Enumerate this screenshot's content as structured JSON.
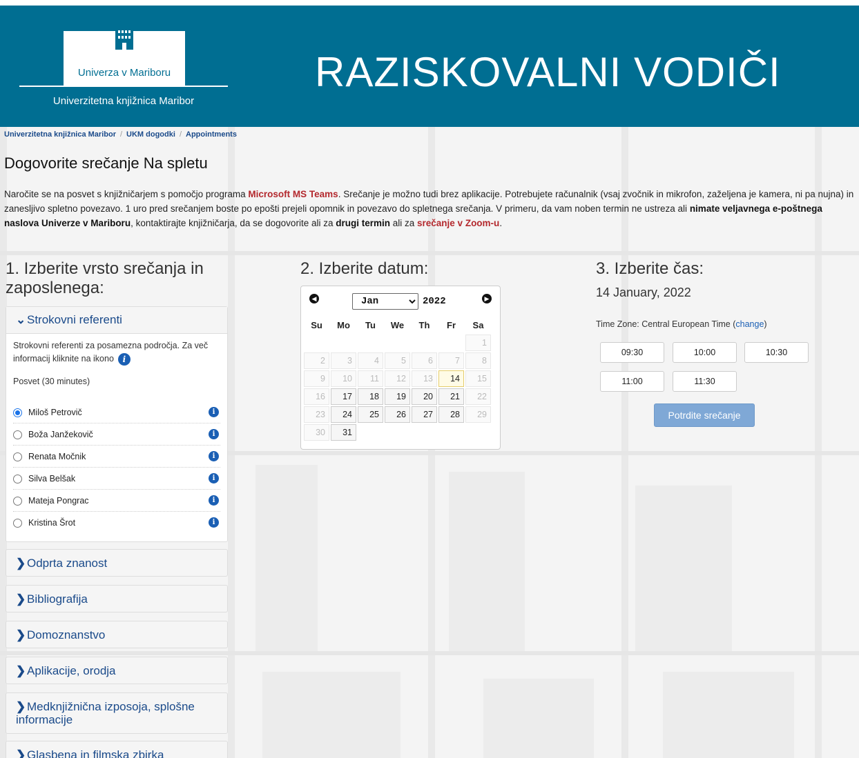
{
  "header": {
    "logo_name": "Univerza v Mariboru",
    "logo_sub": "Univerzitetna knjižnica Maribor",
    "site_title": "RAZISKOVALNI VODIČI",
    "bg_color": "#006e92"
  },
  "breadcrumbs": [
    "Univerzitetna knjižnica Maribor",
    "UKM dogodki",
    "Appointments"
  ],
  "page_title": "Dogovorite srečanje Na spletu",
  "intro": {
    "p1": "Naročite se na posvet s knjižničarjem s pomočjo programa ",
    "teams": "Microsoft MS Teams",
    "p2": ". Srečanje je možno tudi brez aplikacije. Potrebujete računalnik (vsaj zvočnik in mikrofon, zaželjena je kamera, ni pa nujna) in zanesljivo spletno povezavo. 1 uro pred srečanjem boste po epošti prejeli opomnik in povezavo do spletnega srečanja. V primeru, da vam noben termin ne ustreza ali ",
    "no_email": "nimate veljavnega e-poštnega naslova Univerze v Mariboru",
    "p3": ", kontaktirajte knjižničarja, da se dogovorite ali za ",
    "other_term": "drugi termin",
    "p4": " ali za ",
    "zoom": "srečanje v Zoom-u",
    "p5": "."
  },
  "step1": {
    "heading": "1. Izberite vrsto srečanja in zaposlenega:",
    "open_panel": {
      "title": "Strokovni referenti",
      "description": "Strokovni referenti za posamezna področja. Za več informacij kliknite na ikono",
      "duration": "Posvet (30 minutes)",
      "staff": [
        {
          "name": "Miloš Petrovič",
          "selected": true
        },
        {
          "name": "Boža Janžekovič",
          "selected": false
        },
        {
          "name": "Renata Močnik",
          "selected": false
        },
        {
          "name": "Silva Belšak",
          "selected": false
        },
        {
          "name": "Mateja Pongrac",
          "selected": false
        },
        {
          "name": "Kristina Šrot",
          "selected": false
        }
      ]
    },
    "panels": [
      "Odprta znanost",
      "Bibliografija",
      "Domoznanstvo",
      "Aplikacije, orodja",
      "Medknjižnična izposoja, splošne informacije",
      "Glasbena in filmska zbirka"
    ]
  },
  "step2": {
    "heading": "2. Izberite datum:",
    "month": "Jan",
    "year": "2022",
    "weekdays": [
      "Su",
      "Mo",
      "Tu",
      "We",
      "Th",
      "Fr",
      "Sa"
    ],
    "selected_day": 14,
    "available_days": [
      14,
      17,
      18,
      19,
      20,
      21,
      24,
      25,
      26,
      27,
      28,
      31
    ]
  },
  "step3": {
    "heading": "3. Izberite čas:",
    "selected_date": "14 January, 2022",
    "timezone_label": "Time Zone: Central European Time (",
    "timezone_change": "change",
    "timezone_close": ")",
    "slots": [
      "09:30",
      "10:00",
      "10:30",
      "11:00",
      "11:30"
    ],
    "confirm_label": "Potrdite srečanje"
  }
}
